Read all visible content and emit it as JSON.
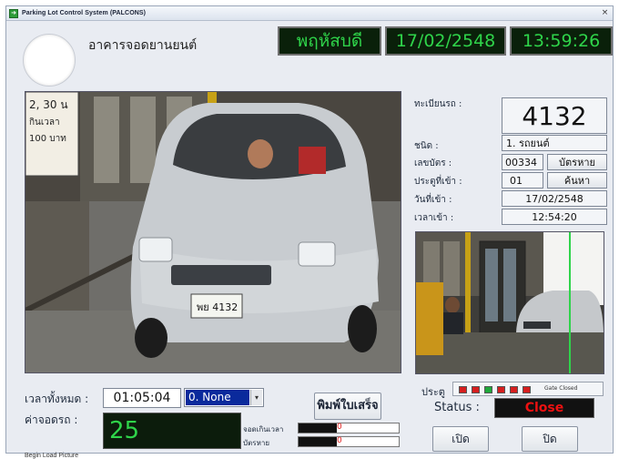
{
  "window": {
    "title": "Parking Lot Control System (PALCONS)",
    "close_glyph": "×"
  },
  "header": {
    "building_name": "อาคารจอดยานยนต์",
    "day": "พฤหัสบดี",
    "date": "17/02/2548",
    "time": "13:59:26"
  },
  "cameras": {
    "main_plate_text": "พย 4132",
    "sign_line1": "2, 30 น",
    "sign_line2": "กินเวลา",
    "sign_line3": "100 บาท"
  },
  "vehicle": {
    "plate_label": "ทะเบียนรถ :",
    "plate_number": "4132",
    "type_label": "ชนิด :",
    "type_value": "1. รถยนต์",
    "card_label": "เลขบัตร :",
    "card_number": "00334",
    "card_button": "บัตรหาย",
    "gate_in_label": "ประตูที่เข้า :",
    "gate_in_value": "01",
    "search_button": "ค้นหา",
    "date_in_label": "วันที่เข้า :",
    "date_in_value": "17/02/2548",
    "time_in_label": "เวลาเข้า :",
    "time_in_value": "12:54:20"
  },
  "controls": {
    "elapsed_label": "เวลาทั้งหมด :",
    "elapsed_value": "01:05:04",
    "discount_selected": "0. None",
    "dropdown_arrow": "▾",
    "print_button": "พิมพ์ใบเสร็จ",
    "fee_label": "ค่าจอดรถ :",
    "fee_value": "25",
    "overtime_label": "จอดเกินเวลา",
    "overtime_value": "0",
    "lost_card_label": "บัตรหาย",
    "lost_card_value": "0"
  },
  "gate": {
    "label": "ประตู",
    "state_text": "Gate Closed",
    "indicators": [
      "#d61f1f",
      "#d61f1f",
      "#1fa83a",
      "#d61f1f",
      "#d61f1f",
      "#d61f1f"
    ],
    "status_label": "Status :",
    "status_value": "Close",
    "open_button": "เปิด",
    "close_button": "ปิด"
  },
  "footer": {
    "status_text": "Begin Load Picture"
  }
}
